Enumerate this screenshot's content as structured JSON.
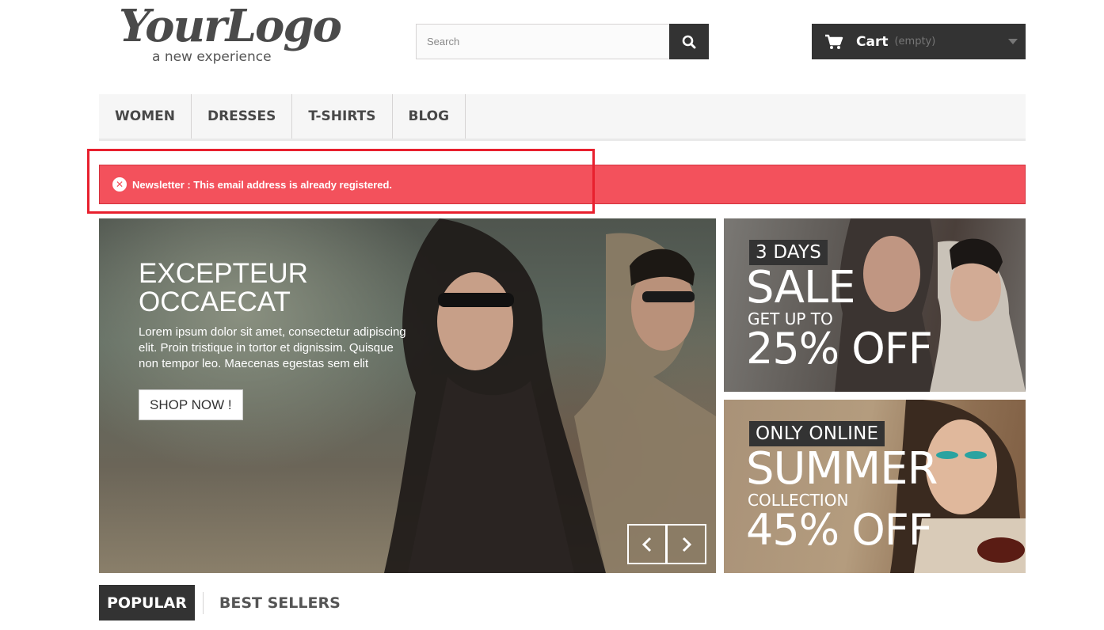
{
  "logo": {
    "script": "YourLogo",
    "tagline": "a new experience"
  },
  "search": {
    "placeholder": "Search",
    "value": "",
    "button_icon": "search-icon"
  },
  "cart": {
    "label": "Cart",
    "status": "(empty)",
    "icon": "shopping-cart-icon"
  },
  "menu": {
    "items": [
      {
        "label": "WOMEN"
      },
      {
        "label": "DRESSES"
      },
      {
        "label": "T-SHIRTS"
      },
      {
        "label": "BLOG"
      }
    ]
  },
  "alert": {
    "message": "Newsletter : This email address is already registered.",
    "icon": "error-circle-icon",
    "color": "#f3515c"
  },
  "slider": {
    "title": "EXCEPTEUR OCCAECAT",
    "description": "Lorem ipsum dolor sit amet, consectetur adipiscing elit. Proin tristique in tortor et dignissim. Quisque non tempor leo. Maecenas egestas sem elit",
    "button": "SHOP NOW !",
    "prev_icon": "chevron-left-icon",
    "next_icon": "chevron-right-icon"
  },
  "banners": [
    {
      "tag": "3 DAYS",
      "headline": "SALE",
      "subline": "GET UP TO",
      "discount": "25% OFF"
    },
    {
      "tag": "ONLY ONLINE",
      "headline": "SUMMER",
      "subline": "COLLECTION",
      "discount": "45% OFF"
    }
  ],
  "tabs": [
    {
      "label": "POPULAR",
      "active": true
    },
    {
      "label": "BEST SELLERS",
      "active": false
    }
  ]
}
